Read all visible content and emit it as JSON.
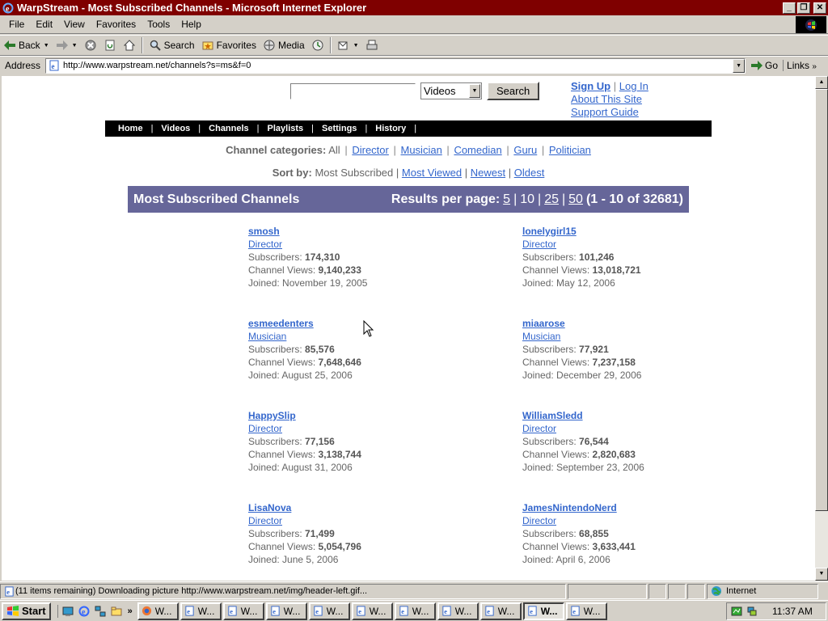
{
  "window": {
    "title": "WarpStream - Most Subscribed Channels - Microsoft Internet Explorer"
  },
  "menu": [
    "File",
    "Edit",
    "View",
    "Favorites",
    "Tools",
    "Help"
  ],
  "toolbar": {
    "back": "Back",
    "search": "Search",
    "favorites": "Favorites",
    "media": "Media"
  },
  "address": {
    "label": "Address",
    "url": "http://www.warpstream.net/channels?s=ms&f=0",
    "go": "Go",
    "links": "Links"
  },
  "site": {
    "search_button": "Search",
    "search_scope": "Videos",
    "sign_up": "Sign Up",
    "log_in": "Log In",
    "about": "About This Site",
    "support": "Support Guide",
    "nav": [
      "Home",
      "Videos",
      "Channels",
      "Playlists",
      "Settings",
      "History"
    ],
    "categories": {
      "label": "Channel categories:",
      "current": "All",
      "links": [
        "Director",
        "Musician",
        "Comedian",
        "Guru",
        "Politician"
      ]
    },
    "sort": {
      "label": "Sort by:",
      "current": "Most Subscribed",
      "links": [
        "Most Viewed",
        "Newest",
        "Oldest"
      ]
    },
    "results": {
      "heading": "Most Subscribed Channels",
      "per_page_label": "Results per page:",
      "options": [
        "5",
        "10",
        "25",
        "50"
      ],
      "current_option": "10",
      "range": "(1 - 10 of 32681)"
    },
    "labels": {
      "subscribers": "Subscribers:",
      "views": "Channel Views:",
      "joined": "Joined:"
    },
    "channels": [
      {
        "name": "smosh",
        "category": "Director",
        "subscribers": "174,310",
        "views": "9,140,233",
        "joined": "November 19, 2005"
      },
      {
        "name": "lonelygirl15",
        "category": "Director",
        "subscribers": "101,246",
        "views": "13,018,721",
        "joined": "May 12, 2006"
      },
      {
        "name": "esmeedenters",
        "category": "Musician",
        "subscribers": "85,576",
        "views": "7,648,646",
        "joined": "August 25, 2006"
      },
      {
        "name": "miaarose",
        "category": "Musician",
        "subscribers": "77,921",
        "views": "7,237,158",
        "joined": "December 29, 2006"
      },
      {
        "name": "HappySlip",
        "category": "Director",
        "subscribers": "77,156",
        "views": "3,138,744",
        "joined": "August 31, 2006"
      },
      {
        "name": "WilliamSledd",
        "category": "Director",
        "subscribers": "76,544",
        "views": "2,820,683",
        "joined": "September 23, 2006"
      },
      {
        "name": "LisaNova",
        "category": "Director",
        "subscribers": "71,499",
        "views": "5,054,796",
        "joined": "June 5, 2006"
      },
      {
        "name": "JamesNintendoNerd",
        "category": "Director",
        "subscribers": "68,855",
        "views": "3,633,441",
        "joined": "April 6, 2006"
      }
    ]
  },
  "status": {
    "text": "(11 items remaining) Downloading picture http://www.warpstream.net/img/header-left.gif...",
    "zone": "Internet"
  },
  "taskbar": {
    "start": "Start",
    "task_label": "W...",
    "clock": "11:37 AM"
  },
  "colors": {
    "titlebar": "#7f0000",
    "link": "#3366cc",
    "results_bar": "#666699"
  }
}
